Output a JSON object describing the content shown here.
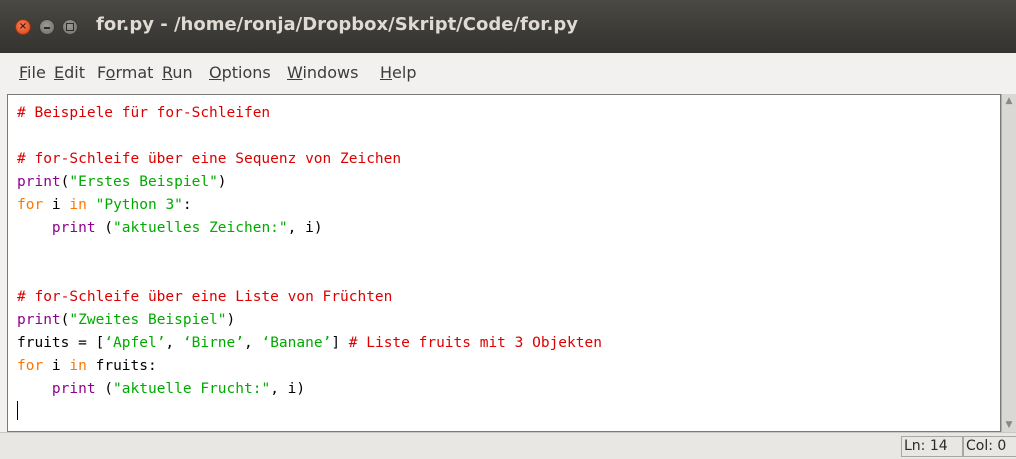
{
  "window": {
    "title": "for.py - /home/ronja/Dropbox/Skript/Code/for.py",
    "close_glyph": "×"
  },
  "menu": {
    "items": [
      {
        "label": "File",
        "mnemonic": "F",
        "rest": "ile"
      },
      {
        "label": "Edit",
        "mnemonic": "E",
        "rest": "dit"
      },
      {
        "label": "Format",
        "mnemonic": "o",
        "pre": "F",
        "rest": "rmat"
      },
      {
        "label": "Run",
        "mnemonic": "R",
        "rest": "un"
      },
      {
        "label": "Options",
        "mnemonic": "O",
        "rest": "ptions"
      },
      {
        "label": "Windows",
        "mnemonic": "W",
        "rest": "indows"
      },
      {
        "label": "Help",
        "mnemonic": "H",
        "rest": "elp"
      }
    ]
  },
  "editor": {
    "lines": [
      [
        {
          "t": "# Beispiele für for-Schleifen",
          "c": "cm"
        }
      ],
      [],
      [
        {
          "t": "# for-Schleife über eine Sequenz von Zeichen",
          "c": "cm"
        }
      ],
      [
        {
          "t": "print",
          "c": "bi"
        },
        {
          "t": "("
        },
        {
          "t": "\"Erstes Beispiel\"",
          "c": "st"
        },
        {
          "t": ")"
        }
      ],
      [
        {
          "t": "for",
          "c": "kw"
        },
        {
          "t": " i "
        },
        {
          "t": "in",
          "c": "kw"
        },
        {
          "t": " "
        },
        {
          "t": "\"Python 3\"",
          "c": "st"
        },
        {
          "t": ":"
        }
      ],
      [
        {
          "t": "    "
        },
        {
          "t": "print",
          "c": "bi"
        },
        {
          "t": " ("
        },
        {
          "t": "\"aktuelles Zeichen:\"",
          "c": "st"
        },
        {
          "t": ", i)"
        }
      ],
      [],
      [],
      [
        {
          "t": "# for-Schleife über eine Liste von Früchten",
          "c": "cm"
        }
      ],
      [
        {
          "t": "print",
          "c": "bi"
        },
        {
          "t": "("
        },
        {
          "t": "\"Zweites Beispiel\"",
          "c": "st"
        },
        {
          "t": ")"
        }
      ],
      [
        {
          "t": "fruits = ["
        },
        {
          "t": "‘Apfel’",
          "c": "st"
        },
        {
          "t": ", "
        },
        {
          "t": "‘Birne’",
          "c": "st"
        },
        {
          "t": ", "
        },
        {
          "t": "‘Banane’",
          "c": "st"
        },
        {
          "t": "] "
        },
        {
          "t": "# Liste fruits mit 3 Objekten",
          "c": "cm"
        }
      ],
      [
        {
          "t": "for",
          "c": "kw"
        },
        {
          "t": " i "
        },
        {
          "t": "in",
          "c": "kw"
        },
        {
          "t": " fruits:"
        }
      ],
      [
        {
          "t": "    "
        },
        {
          "t": "print",
          "c": "bi"
        },
        {
          "t": " ("
        },
        {
          "t": "\"aktuelle Frucht:\"",
          "c": "st"
        },
        {
          "t": ", i)"
        }
      ],
      [
        {
          "cursor": true
        }
      ]
    ],
    "colors": {
      "comment": "#dd0000",
      "keyword": "#ff7700",
      "string": "#00aa00",
      "builtin": "#900090"
    }
  },
  "status": {
    "line": "Ln: 14",
    "col": "Col: 0"
  },
  "icons": {
    "scroll_up": "scroll-up-arrow-icon",
    "scroll_down": "scroll-down-arrow-icon"
  }
}
